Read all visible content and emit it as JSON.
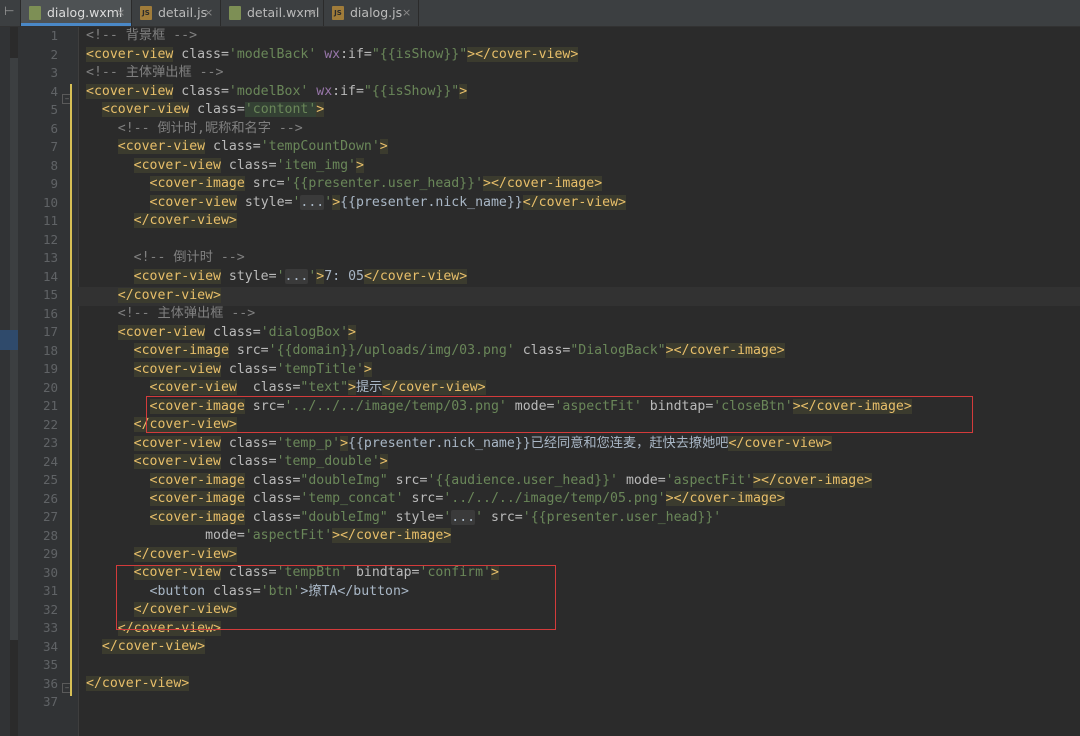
{
  "tabs": [
    {
      "label": "dialog.wxml",
      "icon": "wxml-file-icon",
      "active": true
    },
    {
      "label": "detail.js",
      "icon": "js-file-icon",
      "active": false
    },
    {
      "label": "detail.wxml",
      "icon": "wxml-file-icon",
      "active": false
    },
    {
      "label": "dialog.js",
      "icon": "js-file-icon",
      "active": false
    }
  ],
  "icons": {
    "close": "×",
    "sidebar_toggle": "⊢",
    "js_badge": "JS"
  },
  "line_numbers": [
    "1",
    "2",
    "3",
    "4",
    "5",
    "6",
    "7",
    "8",
    "9",
    "10",
    "11",
    "12",
    "13",
    "14",
    "15",
    "16",
    "17",
    "18",
    "19",
    "20",
    "21",
    "22",
    "23",
    "24",
    "25",
    "26",
    "27",
    "28",
    "29",
    "30",
    "31",
    "32",
    "33",
    "34",
    "35",
    "36",
    "37"
  ],
  "code": {
    "l1": {
      "comment": "<!-- 背景框 -->"
    },
    "l2": {
      "open": "<cover-view",
      "attr": " class=",
      "val": "'modelBack'",
      "attr2": " wx",
      "attr3": ":if=",
      "val2": "\"{{isShow}}\"",
      "gt": ">",
      "close": "</cover-view",
      "gt2": ">"
    },
    "l3": {
      "comment": "<!-- 主体弹出框 -->"
    },
    "l4": {
      "open": "<cover-view",
      "attr": " class=",
      "val": "'modelBox'",
      "attr2": " wx",
      "attr3": ":if=",
      "val2": "\"{{isShow}}\"",
      "gt": ">"
    },
    "l5": {
      "open": "<cover-view",
      "attr": " class=",
      "val": "'contont'",
      "gt": ">"
    },
    "l6": {
      "comment": "<!-- 倒计时,昵称和名字 -->"
    },
    "l7": {
      "open": "<cover-view",
      "attr": " class=",
      "val": "'tempCountDown'",
      "gt": ">"
    },
    "l8": {
      "open": "<cover-view",
      "attr": " class=",
      "val": "'item_img'",
      "gt": ">"
    },
    "l9": {
      "open": "<cover-image",
      "attr": " src=",
      "val": "'{{presenter.user_head}}'",
      "gt": ">",
      "close": "</cover-image",
      "gt2": ">"
    },
    "l10": {
      "open": "<cover-view",
      "attr": " style=",
      "q1": "'",
      "fold": "...",
      "q2": "'",
      "gt": ">",
      "text": "{{presenter.nick_name}}",
      "close": "</cover-view",
      "gt2": ">"
    },
    "l11": {
      "close": "</cover-view",
      "gt": ">"
    },
    "l13": {
      "comment": "<!-- 倒计时 -->"
    },
    "l14": {
      "open": "<cover-view",
      "attr": " style=",
      "q1": "'",
      "fold": "...",
      "q2": "'",
      "gt": ">",
      "text": "7: 05",
      "close": "</cover-view",
      "gt2": ">"
    },
    "l15": {
      "close": "</cover-view",
      "gt": ">"
    },
    "l16": {
      "comment": "<!-- 主体弹出框 -->"
    },
    "l17": {
      "open": "<cover-view",
      "attr": " class=",
      "val": "'dialogBox'",
      "gt": ">"
    },
    "l18": {
      "open": "<cover-image",
      "attr": " src=",
      "val": "'{{domain}}/uploads/img/03.png'",
      "attr2": " class=",
      "val2": "\"DialogBack\"",
      "gt": ">",
      "close": "</cover-image",
      "gt2": ">"
    },
    "l19": {
      "open": "<cover-view",
      "attr": " class=",
      "val": "'tempTitle'",
      "gt": ">"
    },
    "l20": {
      "open": "<cover-view",
      "attr": "  class=",
      "val": "\"text\"",
      "gt": ">",
      "text": "提示",
      "close": "</cover-view",
      "gt2": ">"
    },
    "l21": {
      "open": "<cover-image",
      "attr": " src=",
      "val": "'../../../image/temp/03.png'",
      "attr2": " mode=",
      "val2": "'aspectFit'",
      "attr3": " bindtap=",
      "val3": "'closeBtn'",
      "gt": ">",
      "close": "</cover-image",
      "gt2": ">"
    },
    "l22": {
      "close": "</cover-view",
      "gt": ">"
    },
    "l23": {
      "open": "<cover-view",
      "attr": " class=",
      "val": "'temp_p'",
      "gt": ">",
      "text": "{{presenter.nick_name}}已经同意和您连麦，赶快去撩她吧",
      "close": "</cover-view",
      "gt2": ">"
    },
    "l24": {
      "open": "<cover-view",
      "attr": " class=",
      "val": "'temp_double'",
      "gt": ">"
    },
    "l25": {
      "open": "<cover-image",
      "attr": " class=",
      "val": "\"doubleImg\"",
      "attr2": " src=",
      "val2": "'{{audience.user_head}}'",
      "attr3": " mode=",
      "val3": "'aspectFit'",
      "gt": ">",
      "close": "</cover-image",
      "gt2": ">"
    },
    "l26": {
      "open": "<cover-image",
      "attr": " class=",
      "val": "'temp_concat'",
      "attr2": " src=",
      "val2": "'../../../image/temp/05.png'",
      "gt": ">",
      "close": "</cover-image",
      "gt2": ">"
    },
    "l27": {
      "open": "<cover-image",
      "attr": " class=",
      "val": "\"doubleImg\"",
      "attr2": " style=",
      "q1": "'",
      "fold": "...",
      "q2": "'",
      "attr3": " src=",
      "val3": "'{{presenter.user_head}}'"
    },
    "l28": {
      "attr": "mode=",
      "val": "'aspectFit'",
      "gt": ">",
      "close": "</cover-image",
      "gt2": ">"
    },
    "l29": {
      "close": "</cover-view",
      "gt": ">"
    },
    "l30": {
      "open": "<cover-view",
      "attr": " class=",
      "val": "'tempBtn'",
      "attr2": " bindtap=",
      "val2": "'confirm'",
      "gt": ">"
    },
    "l31": {
      "open": "<button",
      "attr": " class=",
      "val": "'btn'",
      "gt": ">",
      "text": "撩TA",
      "close": "</button>"
    },
    "l32": {
      "close": "</cover-view",
      "gt": ">"
    },
    "l33": {
      "close": "</cover-view",
      "gt": ">"
    },
    "l34": {
      "close": "</cover-view",
      "gt": ">"
    },
    "l36": {
      "close": "</cover-view",
      "gt": ">"
    }
  }
}
